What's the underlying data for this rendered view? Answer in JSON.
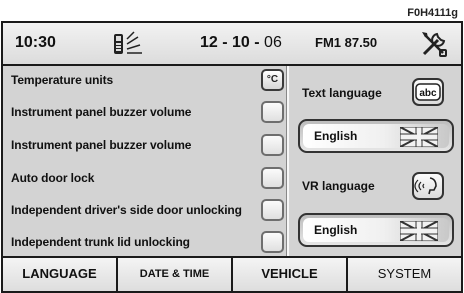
{
  "figure_code": "F0H4111g",
  "status_bar": {
    "time": "10:30",
    "date": "12 - 10 -",
    "year": " 06",
    "radio": "FM1 87.50",
    "phone_icon": "phone-signal-icon",
    "settings_icon": "tools-icon"
  },
  "vehicle_settings": [
    {
      "label": "Temperature units",
      "value": "°C",
      "selected": true
    },
    {
      "label": "Instrument panel buzzer volume",
      "value": "",
      "selected": false
    },
    {
      "label": "Instrument panel buzzer volume",
      "value": "",
      "selected": false
    },
    {
      "label": "Auto door lock",
      "value": "",
      "selected": false
    },
    {
      "label": "Independent driver's side door unlocking",
      "value": "",
      "selected": false
    },
    {
      "label": "Independent trunk lid unlocking",
      "value": "",
      "selected": false
    }
  ],
  "language": {
    "text_label": "Text language",
    "text_value": "English",
    "text_icon": "abc",
    "vr_label": "VR language",
    "vr_value": "English",
    "vr_icon": "voice-recognition-icon",
    "flag_icon": "uk-flag-icon"
  },
  "tabs": [
    "LANGUAGE",
    "DATE & TIME",
    "VEHICLE",
    "SYSTEM"
  ]
}
